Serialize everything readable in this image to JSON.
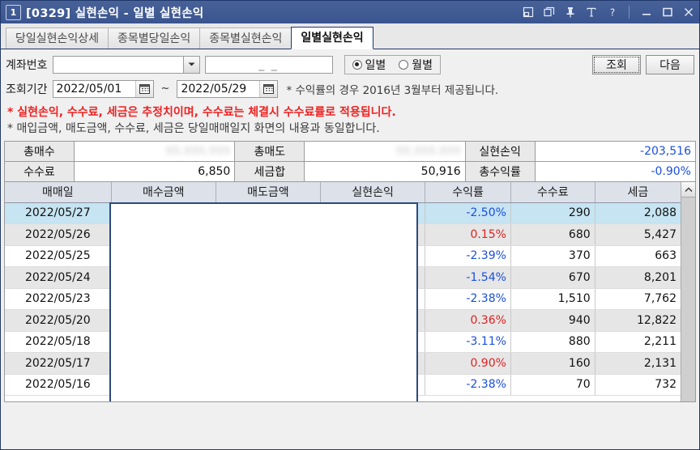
{
  "window": {
    "number": "1",
    "code": "[0329]",
    "title": "실현손익  -  일별 실현손익",
    "full_title": "[0329]  실현손익  -  일별 실현손익",
    "icons": [
      "restore-down-icon",
      "cascade-window-icon",
      "pin-icon",
      "text-size-icon",
      "help-icon",
      "minimize-icon",
      "maximize-icon",
      "close-icon"
    ]
  },
  "tabs": [
    {
      "label": "당일실현손익상세",
      "active": false
    },
    {
      "label": "종목별당일손익",
      "active": false
    },
    {
      "label": "종목별실현손익",
      "active": false
    },
    {
      "label": "일별실현손익",
      "active": true
    }
  ],
  "query": {
    "account_label": "계좌번호",
    "account_value": "",
    "account_placeholder": "",
    "password_value": "_ _",
    "period_label": "조회기간",
    "date_from": "2022/05/01",
    "date_to": "2022/05/29",
    "tilde": "~",
    "radio_daily": "일별",
    "radio_monthly": "월별",
    "radio_selected": "일별",
    "search_button": "조회",
    "next_button": "다음",
    "rate_note": "* 수익률의 경우 2016년 3월부터 제공됩니다."
  },
  "notes": [
    "* 실현손익, 수수료, 세금은 추정치이며, 수수료는 체결시 수수료률로 적용됩니다.",
    "* 매입금액, 매도금액, 수수료, 세금은 당일매매일지 화면의 내용과 동일합니다."
  ],
  "summary": {
    "rows": [
      [
        {
          "label": "총매수",
          "value": "",
          "redacted": true,
          "color": "normal"
        },
        {
          "label": "총매도",
          "value": "",
          "redacted": true,
          "color": "normal"
        },
        {
          "label": "실현손익",
          "value": "-203,516",
          "redacted": false,
          "color": "negative"
        }
      ],
      [
        {
          "label": "수수료",
          "value": "6,850",
          "redacted": false,
          "color": "normal"
        },
        {
          "label": "세금합",
          "value": "50,916",
          "redacted": false,
          "color": "normal"
        },
        {
          "label": "총수익률",
          "value": "-0.90%",
          "redacted": false,
          "color": "negative"
        }
      ]
    ]
  },
  "table": {
    "columns": [
      "매매일",
      "매수금액",
      "매도금액",
      "실현손익",
      "수익률",
      "수수료",
      "세금"
    ],
    "redacted_columns": [
      "매수금액",
      "매도금액",
      "실현손익"
    ],
    "scroll_up_icon": "chevron-up-icon",
    "rows": [
      {
        "date": "2022/05/27",
        "buy": "",
        "sell": "",
        "pnl": "",
        "rate": "-2.50%",
        "rate_sign": "neg",
        "fee": "290",
        "tax": "2,088",
        "selected": true
      },
      {
        "date": "2022/05/26",
        "buy": "",
        "sell": "",
        "pnl": "",
        "rate": "0.15%",
        "rate_sign": "pos",
        "fee": "680",
        "tax": "5,427",
        "selected": false
      },
      {
        "date": "2022/05/25",
        "buy": "",
        "sell": "",
        "pnl": "",
        "rate": "-2.39%",
        "rate_sign": "neg",
        "fee": "370",
        "tax": "663",
        "selected": false
      },
      {
        "date": "2022/05/24",
        "buy": "",
        "sell": "",
        "pnl": "",
        "rate": "-1.54%",
        "rate_sign": "neg",
        "fee": "670",
        "tax": "8,201",
        "selected": false
      },
      {
        "date": "2022/05/23",
        "buy": "",
        "sell": "",
        "pnl": "",
        "rate": "-2.38%",
        "rate_sign": "neg",
        "fee": "1,510",
        "tax": "7,762",
        "selected": false
      },
      {
        "date": "2022/05/20",
        "buy": "",
        "sell": "",
        "pnl": "",
        "rate": "0.36%",
        "rate_sign": "pos",
        "fee": "940",
        "tax": "12,822",
        "selected": false
      },
      {
        "date": "2022/05/18",
        "buy": "",
        "sell": "",
        "pnl": "",
        "rate": "-3.11%",
        "rate_sign": "neg",
        "fee": "880",
        "tax": "2,211",
        "selected": false
      },
      {
        "date": "2022/05/17",
        "buy": "",
        "sell": "",
        "pnl": "",
        "rate": "0.90%",
        "rate_sign": "pos",
        "fee": "160",
        "tax": "2,131",
        "selected": false
      },
      {
        "date": "2022/05/16",
        "buy": "",
        "sell": "",
        "pnl": "",
        "rate": "-2.38%",
        "rate_sign": "neg",
        "fee": "70",
        "tax": "732",
        "selected": false
      }
    ]
  },
  "colors": {
    "title_bar": "#3e5a96",
    "positive": "#e02020",
    "negative": "#1a4fe0",
    "selected_row": "#c6e4f2",
    "alt_row": "#e6e6e6",
    "header": "#dde1e9",
    "note_warning": "#ee2222"
  }
}
